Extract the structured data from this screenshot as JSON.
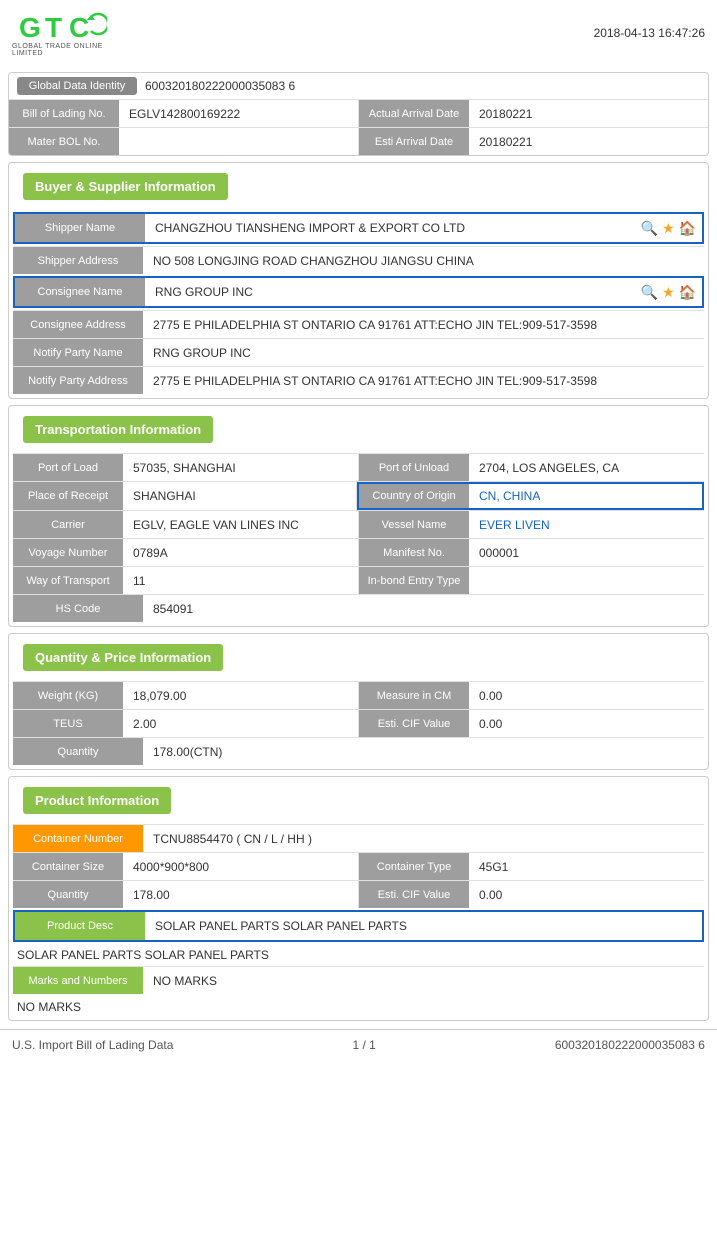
{
  "header": {
    "datetime": "2018-04-13 16:47:26"
  },
  "logo": {
    "text": "GTC",
    "subtitle": "GLOBAL TRADE ONLINE LIMITED"
  },
  "identity": {
    "global_data_identity_label": "Global Data Identity",
    "global_data_identity_value": "600320180222000035083 6",
    "bill_of_lading_label": "Bill of Lading No.",
    "bill_of_lading_value": "EGLV142800169222",
    "actual_arrival_label": "Actual Arrival Date",
    "actual_arrival_value": "20180221",
    "mater_bol_label": "Mater BOL No.",
    "mater_bol_value": "",
    "esti_arrival_label": "Esti Arrival Date",
    "esti_arrival_value": "20180221"
  },
  "buyer_supplier": {
    "section_title": "Buyer & Supplier Information",
    "shipper_name_label": "Shipper Name",
    "shipper_name_value": "CHANGZHOU TIANSHENG IMPORT & EXPORT CO LTD",
    "shipper_address_label": "Shipper Address",
    "shipper_address_value": "NO 508 LONGJING ROAD CHANGZHOU JIANGSU CHINA",
    "consignee_name_label": "Consignee Name",
    "consignee_name_value": "RNG GROUP INC",
    "consignee_address_label": "Consignee Address",
    "consignee_address_value": "2775 E PHILADELPHIA ST ONTARIO CA 91761 ATT:ECHO JIN TEL:909-517-3598",
    "notify_party_name_label": "Notify Party Name",
    "notify_party_name_value": "RNG GROUP INC",
    "notify_party_address_label": "Notify Party Address",
    "notify_party_address_value": "2775 E PHILADELPHIA ST ONTARIO CA 91761 ATT:ECHO JIN TEL:909-517-3598"
  },
  "transportation": {
    "section_title": "Transportation Information",
    "port_of_load_label": "Port of Load",
    "port_of_load_value": "57035, SHANGHAI",
    "port_of_unload_label": "Port of Unload",
    "port_of_unload_value": "2704, LOS ANGELES, CA",
    "place_of_receipt_label": "Place of Receipt",
    "place_of_receipt_value": "SHANGHAI",
    "country_of_origin_label": "Country of Origin",
    "country_of_origin_value": "CN, CHINA",
    "carrier_label": "Carrier",
    "carrier_value": "EGLV, EAGLE VAN LINES INC",
    "vessel_name_label": "Vessel Name",
    "vessel_name_value": "EVER LIVEN",
    "voyage_number_label": "Voyage Number",
    "voyage_number_value": "0789A",
    "manifest_no_label": "Manifest No.",
    "manifest_no_value": "000001",
    "way_of_transport_label": "Way of Transport",
    "way_of_transport_value": "11",
    "in_bond_label": "In-bond Entry Type",
    "in_bond_value": "",
    "hs_code_label": "HS Code",
    "hs_code_value": "854091"
  },
  "quantity_price": {
    "section_title": "Quantity & Price Information",
    "weight_label": "Weight (KG)",
    "weight_value": "18,079.00",
    "measure_cm_label": "Measure in CM",
    "measure_cm_value": "0.00",
    "teus_label": "TEUS",
    "teus_value": "2.00",
    "esti_cif_label": "Esti. CIF Value",
    "esti_cif_value": "0.00",
    "quantity_label": "Quantity",
    "quantity_value": "178.00(CTN)"
  },
  "product_info": {
    "section_title": "Product Information",
    "container_number_label": "Container Number",
    "container_number_value": "TCNU8854470 ( CN / L / HH )",
    "container_size_label": "Container Size",
    "container_size_value": "4000*900*800",
    "container_type_label": "Container Type",
    "container_type_value": "45G1",
    "quantity_label": "Quantity",
    "quantity_value": "178.00",
    "esti_cif_label": "Esti. CIF Value",
    "esti_cif_value": "0.00",
    "product_desc_label": "Product Desc",
    "product_desc_value": "SOLAR PANEL PARTS SOLAR PANEL PARTS",
    "marks_label": "Marks and Numbers",
    "marks_value": "NO MARKS"
  },
  "footer": {
    "left": "U.S. Import Bill of Lading Data",
    "center": "1 / 1",
    "right": "600320180222000035083 6"
  }
}
